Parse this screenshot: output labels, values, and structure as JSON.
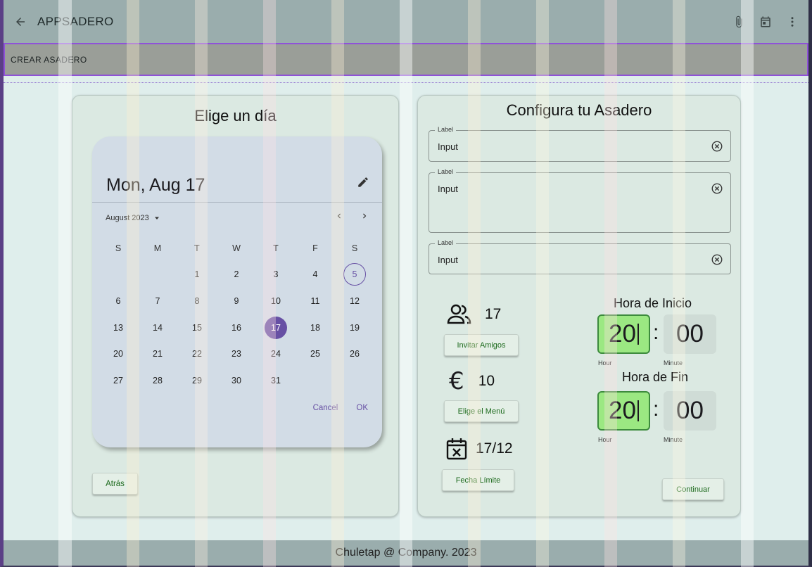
{
  "appbar": {
    "title": "APPSADERO"
  },
  "subbar": {
    "title": "CREAR ASADERO"
  },
  "left_card": {
    "title": "Elige un día",
    "back_button": "Atrás",
    "picker": {
      "headline": "Mon, Aug 17",
      "month_label": "August 2023",
      "weekdays": [
        "S",
        "M",
        "T",
        "W",
        "T",
        "F",
        "S"
      ],
      "weeks": [
        [
          "",
          "",
          "1",
          "2",
          "3",
          "4",
          "5"
        ],
        [
          "6",
          "7",
          "8",
          "9",
          "10",
          "11",
          "12"
        ],
        [
          "13",
          "14",
          "15",
          "16",
          "17",
          "18",
          "19"
        ],
        [
          "20",
          "21",
          "22",
          "23",
          "24",
          "25",
          "26"
        ],
        [
          "27",
          "28",
          "29",
          "30",
          "31",
          "",
          ""
        ]
      ],
      "today": "5",
      "selected": "17",
      "cancel": "Cancel",
      "ok": "OK"
    }
  },
  "right_card": {
    "title": "Configura tu Asadero",
    "fields": [
      {
        "label": "Label",
        "value": "Input"
      },
      {
        "label": "Label",
        "value": "Input"
      },
      {
        "label": "Label",
        "value": "Input"
      }
    ],
    "guests": {
      "count": "17",
      "button": "Invitar Amigos",
      "icon": "people-icon"
    },
    "price": {
      "value": "10",
      "button": "Elige el Menú",
      "icon": "euro-icon"
    },
    "deadline": {
      "value": "17/12",
      "button": "Fecha Límite",
      "icon": "calendar-cancel-icon"
    },
    "start_time": {
      "title": "Hora de Inicio",
      "hour": "20",
      "minute": "00",
      "hour_label": "Hour",
      "minute_label": "Minute"
    },
    "end_time": {
      "title": "Hora de Fin",
      "hour": "20",
      "minute": "00",
      "hour_label": "Hour",
      "minute_label": "Minute"
    },
    "continue_button": "Continuar"
  },
  "footer": {
    "text": "Chuletap @ Company. 2023"
  },
  "colors": {
    "accent": "#6750a4",
    "time_active": "#9be882",
    "button_text": "#1d6a1d"
  }
}
